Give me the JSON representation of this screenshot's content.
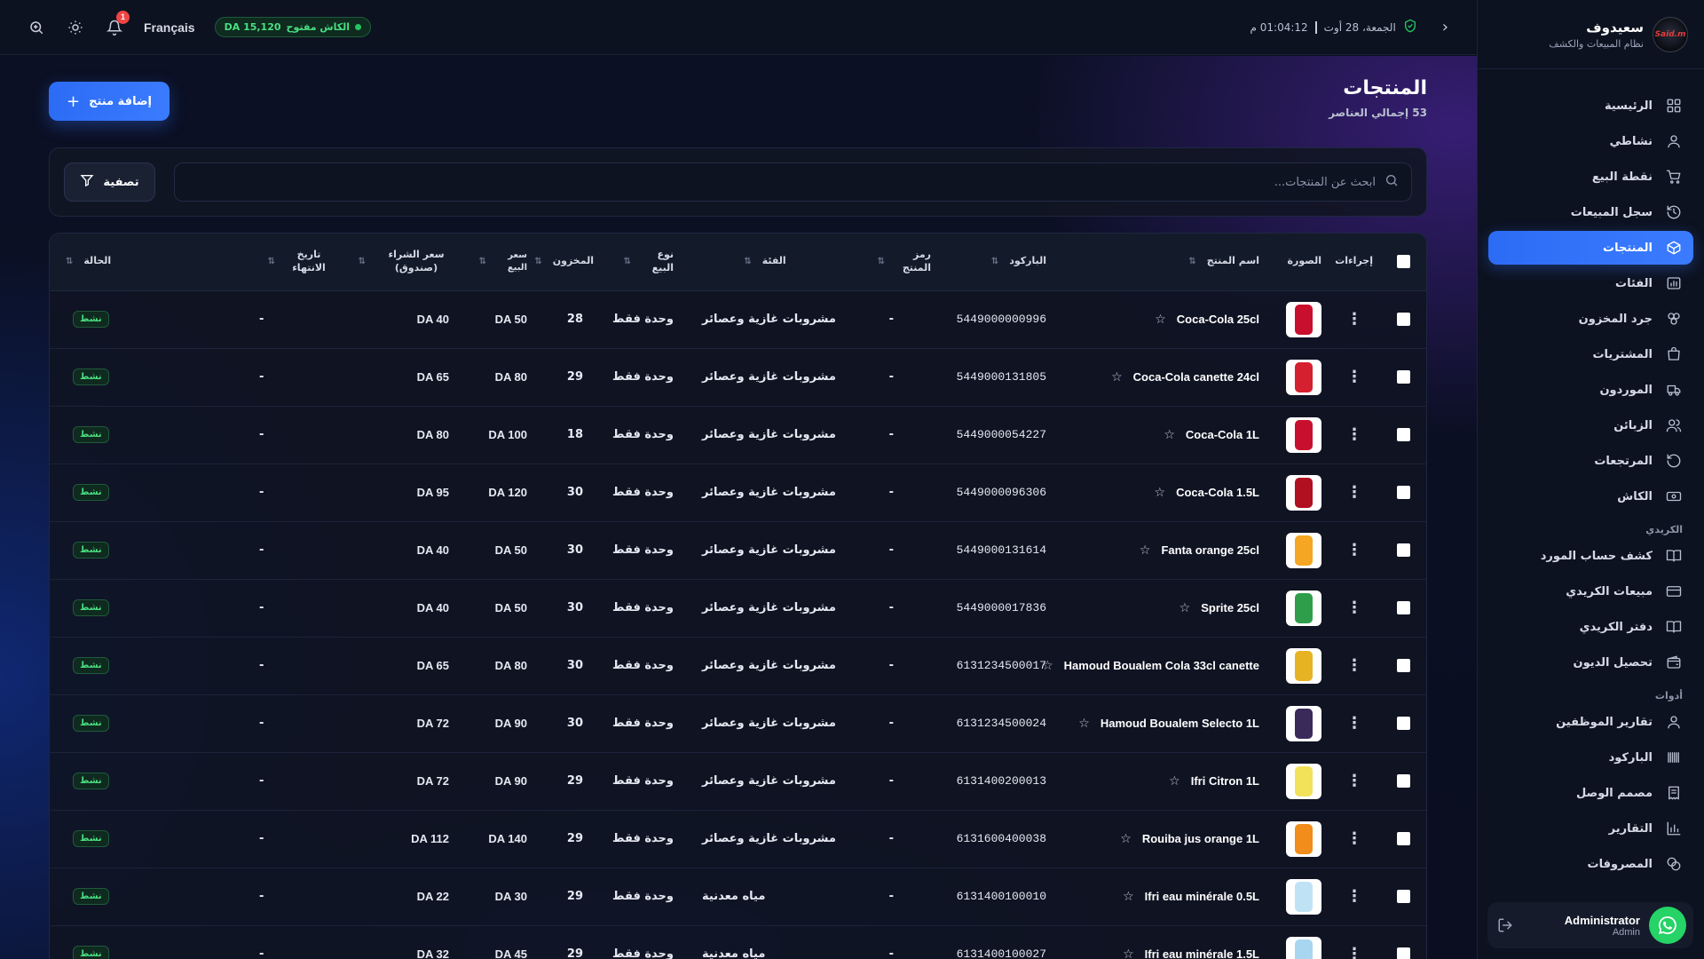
{
  "app": {
    "brand_name": "سعيدوف",
    "brand_sub": "نظام المبيعات والكشف",
    "logo_text": "Said.m"
  },
  "topbar": {
    "date": "الجمعة، 28 أوت",
    "time": "01:04:12 م",
    "cash_label": "الكاش مفتوح",
    "cash_amount": "DA 15,120",
    "language": "Français",
    "notification_count": "1"
  },
  "sidebar": {
    "items": [
      {
        "label": "الرئيسية",
        "icon": "dashboard-icon"
      },
      {
        "label": "نشاطي",
        "icon": "user-icon"
      },
      {
        "label": "نقطة البيع",
        "icon": "cart-icon"
      },
      {
        "label": "سجل المبيعات",
        "icon": "history-icon"
      },
      {
        "label": "المنتجات",
        "icon": "box-icon",
        "active": true
      },
      {
        "label": "الفئات",
        "icon": "categories-icon"
      },
      {
        "label": "جرد المخزون",
        "icon": "stock-icon"
      },
      {
        "label": "المشتريات",
        "icon": "purchases-icon"
      },
      {
        "label": "الموردون",
        "icon": "truck-icon"
      },
      {
        "label": "الزبائن",
        "icon": "customers-icon"
      },
      {
        "label": "المرتجعات",
        "icon": "returns-icon"
      },
      {
        "label": "الكاش",
        "icon": "cash-icon"
      }
    ],
    "section_credit": "الكريدي",
    "credit_items": [
      {
        "label": "كشف حساب المورد",
        "icon": "book-icon"
      },
      {
        "label": "مبيعات الكريدي",
        "icon": "card-icon"
      },
      {
        "label": "دفتر الكريدي",
        "icon": "ledger-icon"
      },
      {
        "label": "تحصيل الديون",
        "icon": "wallet-icon"
      }
    ],
    "section_tools": "أدوات",
    "tool_items": [
      {
        "label": "تقارير الموظفين",
        "icon": "employees-icon"
      },
      {
        "label": "الباركود",
        "icon": "barcode-icon"
      },
      {
        "label": "مصمم الوصل",
        "icon": "receipt-icon"
      },
      {
        "label": "التقارير",
        "icon": "chart-icon"
      },
      {
        "label": "المصروفات",
        "icon": "expenses-icon"
      }
    ],
    "user_name": "Administrator",
    "user_role": "Admin"
  },
  "page": {
    "title": "المنتجات",
    "count": "53 إجمالي العناصر",
    "add_button": "إضافة منتج",
    "search_placeholder": "ابحث عن المنتجات...",
    "filter_button": "تصفية"
  },
  "table": {
    "headers": {
      "actions": "إجراءات",
      "image": "الصورة",
      "name": "اسم المنتج",
      "barcode": "الباركود",
      "code": "رمز المنتج",
      "category": "الفئة",
      "sale_type": "نوع البيع",
      "stock": "المخزون",
      "sale_price": "سعر البيع",
      "buy_price": "سعر الشراء (صندوق)",
      "expiry": "تاريخ الانتهاء",
      "status": "الحالة"
    },
    "rows": [
      {
        "name": "Coca-Cola 25cl",
        "barcode": "5449000000996",
        "code": "-",
        "category": "مشروبات غازية وعصائر",
        "sale_type": "وحدة فقط",
        "stock": "28",
        "sale_price": "DA 50",
        "buy_price": "DA 40",
        "expiry": "-",
        "status": "نشط",
        "thumb": "#c8102e"
      },
      {
        "name": "Coca-Cola canette 24cl",
        "barcode": "5449000131805",
        "code": "-",
        "category": "مشروبات غازية وعصائر",
        "sale_type": "وحدة فقط",
        "stock": "29",
        "sale_price": "DA 80",
        "buy_price": "DA 65",
        "expiry": "-",
        "status": "نشط",
        "thumb": "#d4202f"
      },
      {
        "name": "Coca-Cola 1L",
        "barcode": "5449000054227",
        "code": "-",
        "category": "مشروبات غازية وعصائر",
        "sale_type": "وحدة فقط",
        "stock": "18",
        "sale_price": "DA 100",
        "buy_price": "DA 80",
        "expiry": "-",
        "status": "نشط",
        "thumb": "#c8102e"
      },
      {
        "name": "Coca-Cola 1.5L",
        "barcode": "5449000096306",
        "code": "-",
        "category": "مشروبات غازية وعصائر",
        "sale_type": "وحدة فقط",
        "stock": "30",
        "sale_price": "DA 120",
        "buy_price": "DA 95",
        "expiry": "-",
        "status": "نشط",
        "thumb": "#b01020"
      },
      {
        "name": "Fanta orange 25cl",
        "barcode": "5449000131614",
        "code": "-",
        "category": "مشروبات غازية وعصائر",
        "sale_type": "وحدة فقط",
        "stock": "30",
        "sale_price": "DA 50",
        "buy_price": "DA 40",
        "expiry": "-",
        "status": "نشط",
        "thumb": "#f5a623"
      },
      {
        "name": "Sprite 25cl",
        "barcode": "5449000017836",
        "code": "-",
        "category": "مشروبات غازية وعصائر",
        "sale_type": "وحدة فقط",
        "stock": "30",
        "sale_price": "DA 50",
        "buy_price": "DA 40",
        "expiry": "-",
        "status": "نشط",
        "thumb": "#2e9e4a"
      },
      {
        "name": "Hamoud Boualem Cola 33cl canette",
        "barcode": "6131234500017",
        "code": "-",
        "category": "مشروبات غازية وعصائر",
        "sale_type": "وحدة فقط",
        "stock": "30",
        "sale_price": "DA 80",
        "buy_price": "DA 65",
        "expiry": "-",
        "status": "نشط",
        "thumb": "#e6b422"
      },
      {
        "name": "Hamoud Boualem Selecto 1L",
        "barcode": "6131234500024",
        "code": "-",
        "category": "مشروبات غازية وعصائر",
        "sale_type": "وحدة فقط",
        "stock": "30",
        "sale_price": "DA 90",
        "buy_price": "DA 72",
        "expiry": "-",
        "status": "نشط",
        "thumb": "#3a2a5a"
      },
      {
        "name": "Ifri Citron 1L",
        "barcode": "6131400200013",
        "code": "-",
        "category": "مشروبات غازية وعصائر",
        "sale_type": "وحدة فقط",
        "stock": "29",
        "sale_price": "DA 90",
        "buy_price": "DA 72",
        "expiry": "-",
        "status": "نشط",
        "thumb": "#f2e25a"
      },
      {
        "name": "Rouiba jus orange 1L",
        "barcode": "6131600400038",
        "code": "-",
        "category": "مشروبات غازية وعصائر",
        "sale_type": "وحدة فقط",
        "stock": "29",
        "sale_price": "DA 140",
        "buy_price": "DA 112",
        "expiry": "-",
        "status": "نشط",
        "thumb": "#f28c1a"
      },
      {
        "name": "Ifri eau minérale 0.5L",
        "barcode": "6131400100010",
        "code": "-",
        "category": "مياه معدنية",
        "sale_type": "وحدة فقط",
        "stock": "29",
        "sale_price": "DA 30",
        "buy_price": "DA 22",
        "expiry": "-",
        "status": "نشط",
        "thumb": "#bfe3f5"
      },
      {
        "name": "Ifri eau minérale 1.5L",
        "barcode": "6131400100027",
        "code": "-",
        "category": "مياه معدنية",
        "sale_type": "وحدة فقط",
        "stock": "29",
        "sale_price": "DA 45",
        "buy_price": "DA 32",
        "expiry": "-",
        "status": "نشط",
        "thumb": "#a8d6f0"
      }
    ]
  },
  "colors": {
    "accent": "#3373ff",
    "status_green": "#4ade80",
    "background": "#0b0f1c"
  }
}
